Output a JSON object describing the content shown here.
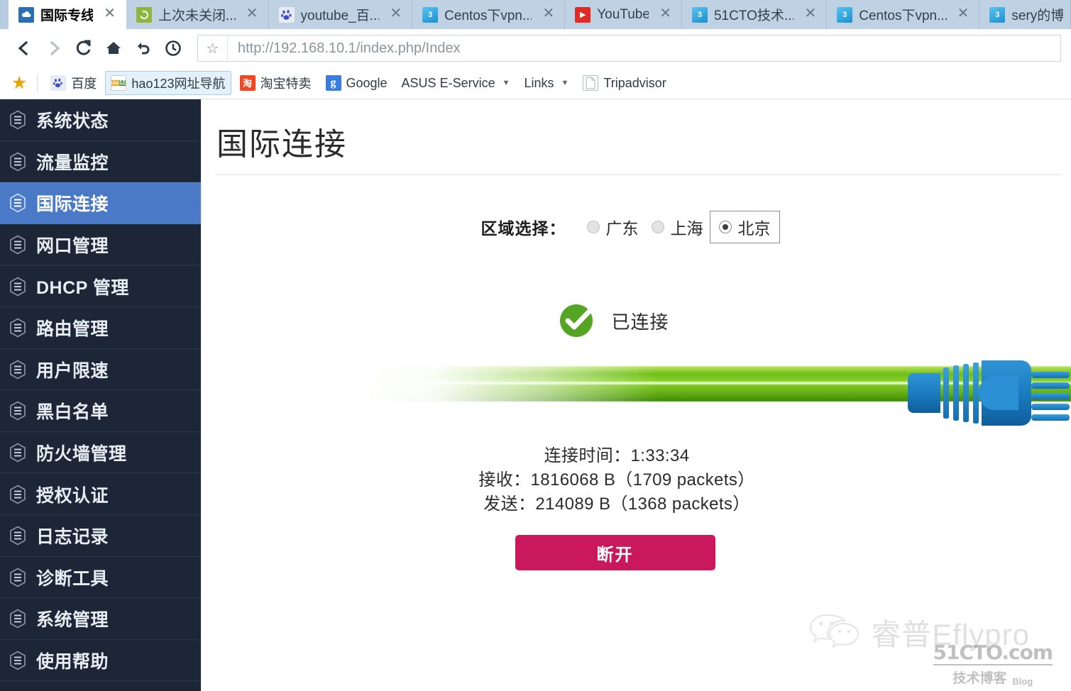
{
  "browser": {
    "tabs": [
      {
        "title": "国际专线",
        "favicon": "cloud-icon",
        "active": true,
        "closable": true
      },
      {
        "title": "上次未关闭...",
        "favicon": "restore-icon",
        "active": false,
        "closable": true
      },
      {
        "title": "youtube_百...",
        "favicon": "baidu-icon",
        "active": false,
        "closable": true
      },
      {
        "title": "Centos下vpn...",
        "favicon": "51cto-icon",
        "active": false,
        "closable": true
      },
      {
        "title": "YouTube",
        "favicon": "youtube-icon",
        "active": false,
        "closable": true
      },
      {
        "title": "51CTO技术...",
        "favicon": "51cto-icon",
        "active": false,
        "closable": true
      },
      {
        "title": "Centos下vpn...",
        "favicon": "51cto-icon",
        "active": false,
        "closable": true
      },
      {
        "title": "sery的博",
        "favicon": "51cto-icon",
        "active": false,
        "closable": false
      }
    ],
    "nav": {
      "back": "back-arrow-icon",
      "forward": "forward-arrow-icon",
      "reload": "reload-icon",
      "home": "home-icon",
      "undo": "undo-icon",
      "history": "clock-icon"
    },
    "url": "http://192.168.10.1/index.php/Index",
    "bookmarks": [
      {
        "label": "百度",
        "icon": "baidu-icon",
        "highlight": false
      },
      {
        "label": "hao123网址导航",
        "icon": "hao123-icon",
        "highlight": true
      },
      {
        "label": "淘宝特卖",
        "icon": "taobao-icon",
        "highlight": false
      },
      {
        "label": "Google",
        "icon": "google-icon",
        "highlight": false
      },
      {
        "label": "ASUS E-Service",
        "icon": "none",
        "highlight": false,
        "caret": true
      },
      {
        "label": "Links",
        "icon": "none",
        "highlight": false,
        "caret": true
      },
      {
        "label": "Tripadvisor",
        "icon": "document-icon",
        "highlight": false
      }
    ]
  },
  "sidebar": {
    "items": [
      {
        "label": "系统状态",
        "active": false
      },
      {
        "label": "流量监控",
        "active": false
      },
      {
        "label": "国际连接",
        "active": true
      },
      {
        "label": "网口管理",
        "active": false
      },
      {
        "label": "DHCP 管理",
        "active": false
      },
      {
        "label": "路由管理",
        "active": false
      },
      {
        "label": "用户限速",
        "active": false
      },
      {
        "label": "黑白名单",
        "active": false
      },
      {
        "label": "防火墙管理",
        "active": false
      },
      {
        "label": "授权认证",
        "active": false
      },
      {
        "label": "日志记录",
        "active": false
      },
      {
        "label": "诊断工具",
        "active": false
      },
      {
        "label": "系统管理",
        "active": false
      },
      {
        "label": "使用帮助",
        "active": false
      }
    ]
  },
  "main": {
    "page_title": "国际连接",
    "region": {
      "label": "区域选择：",
      "options": [
        {
          "label": "广东",
          "selected": false,
          "focused": false
        },
        {
          "label": "上海",
          "selected": false,
          "focused": false
        },
        {
          "label": "北京",
          "selected": true,
          "focused": true
        }
      ]
    },
    "connection": {
      "status_text": "已连接",
      "status_icon": "green-check-circle-icon",
      "plug_icon": "rj45-plug-icon",
      "stats": [
        "连接时间：1:33:34",
        "接收：1816068 B（1709 packets）",
        "发送：214089 B（1368 packets）"
      ],
      "uptime": "1:33:34",
      "received_bytes": "1816068 B",
      "received_packets": "1709 packets",
      "sent_bytes": "214089 B",
      "sent_packets": "1368 packets"
    },
    "disconnect_label": "断开"
  },
  "watermark": {
    "wechat_icon": "wechat-icon",
    "brand": "睿普Eflypro",
    "site": "51CTO.com",
    "site_cn": "技术博客",
    "site_blog": "Blog"
  },
  "colors": {
    "sidebar_bg": "#1c2636",
    "sidebar_active": "#4a7ac7",
    "disconnect": "#c9185c",
    "status_green": "#55a524",
    "cable_green": "#6fbd18",
    "plug_blue": "#1b7cc0",
    "tabstrip": "#b8cce0"
  }
}
